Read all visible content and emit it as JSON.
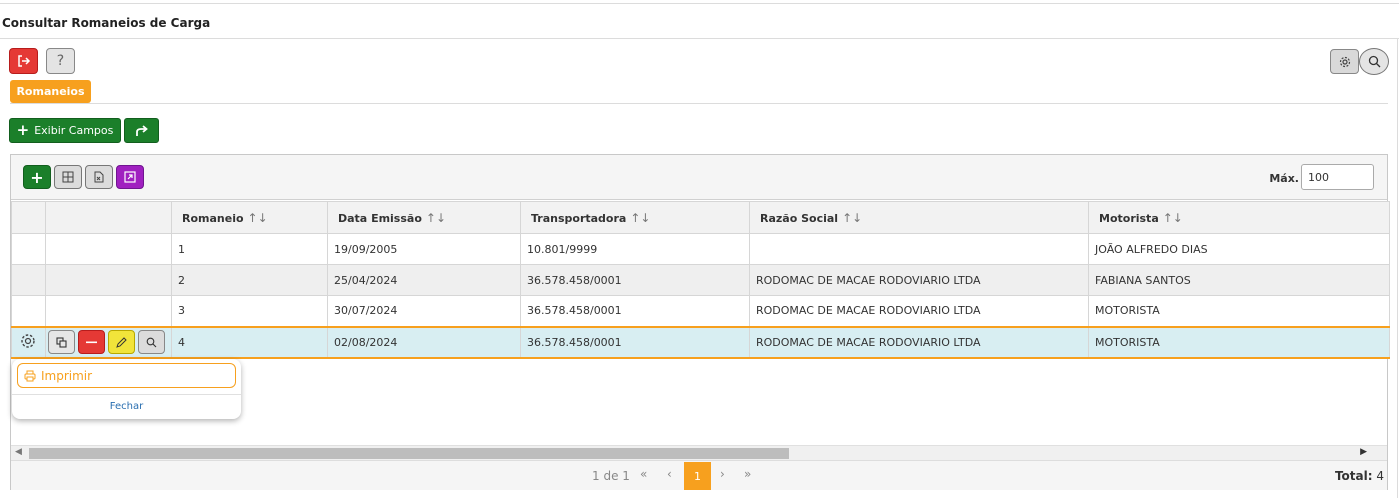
{
  "page": {
    "title": "Consultar Romaneios de Carga"
  },
  "toolbar": {
    "help_label": "?"
  },
  "tabs": [
    {
      "label": "Romaneios",
      "active": true
    }
  ],
  "actions": {
    "exibir_campos_label": "Exibir Campos"
  },
  "grid": {
    "max_label": "Máx.",
    "max_value": "100",
    "columns": [
      "Romaneio",
      "Data Emissão",
      "Transportadora",
      "Razão Social",
      "Motorista"
    ],
    "rows": [
      {
        "romaneio": "1",
        "data": "19/09/2005",
        "transportadora": "10.801/9999",
        "razao": "",
        "motorista": "JOÃO ALFREDO DIAS"
      },
      {
        "romaneio": "2",
        "data": "25/04/2024",
        "transportadora": "36.578.458/0001",
        "razao": "RODOMAC DE MACAE RODOVIARIO LTDA",
        "motorista": "FABIANA SANTOS"
      },
      {
        "romaneio": "3",
        "data": "30/07/2024",
        "transportadora": "36.578.458/0001",
        "razao": "RODOMAC DE MACAE RODOVIARIO LTDA",
        "motorista": "MOTORISTA"
      },
      {
        "romaneio": "4",
        "data": "02/08/2024",
        "transportadora": "36.578.458/0001",
        "razao": "RODOMAC DE MACAE RODOVIARIO LTDA",
        "motorista": "MOTORISTA"
      }
    ],
    "selected_row": 4
  },
  "popup": {
    "print_label": "Imprimir",
    "close_label": "Fechar"
  },
  "pager": {
    "info": "1 de 1",
    "first": "«",
    "prev": "‹",
    "current": "1",
    "next": "›",
    "last": "»",
    "total_label": "Total:",
    "total_value": "4"
  },
  "colors": {
    "accent": "#f7a01e",
    "green": "#1b7f2a",
    "red": "#e53935",
    "purple": "#a020c0",
    "selected_row": "#d8eef2"
  }
}
